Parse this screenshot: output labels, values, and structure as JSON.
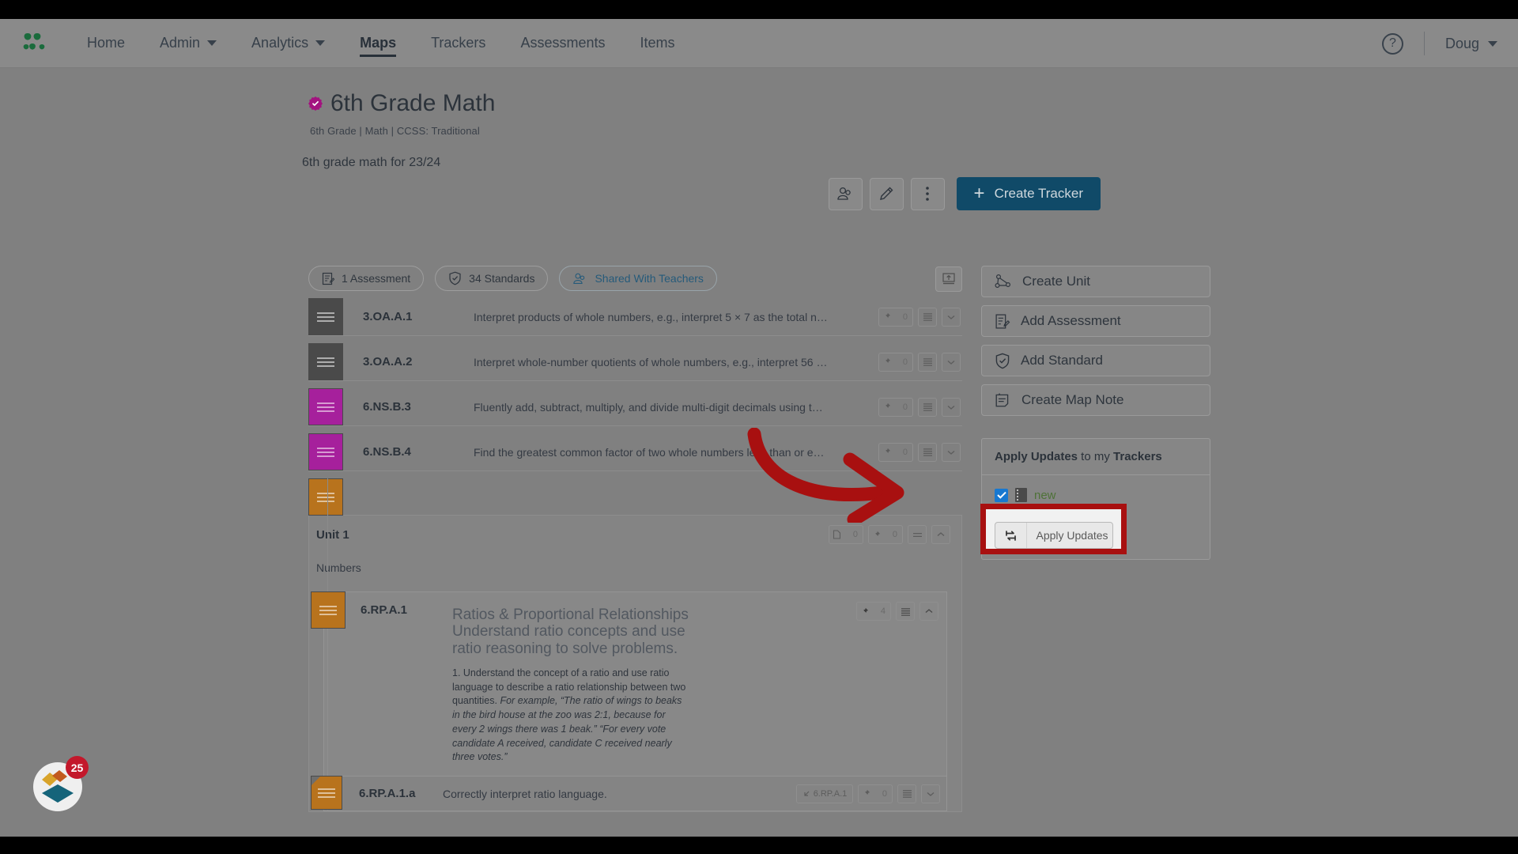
{
  "nav": {
    "logo_icon": "leaf-cluster-logo",
    "links": [
      {
        "label": "Home",
        "has_caret": false,
        "active": false
      },
      {
        "label": "Admin",
        "has_caret": true,
        "active": false
      },
      {
        "label": "Analytics",
        "has_caret": true,
        "active": false
      },
      {
        "label": "Maps",
        "has_caret": false,
        "active": true
      },
      {
        "label": "Trackers",
        "has_caret": false,
        "active": false
      },
      {
        "label": "Assessments",
        "has_caret": false,
        "active": false
      },
      {
        "label": "Items",
        "has_caret": false,
        "active": false
      }
    ],
    "help_label": "?",
    "user_name": "Doug"
  },
  "page": {
    "title": "6th Grade Math",
    "meta": "6th Grade | Math | CCSS: Traditional",
    "description": "6th grade math for 23/24",
    "actions": {
      "share_icon": "people-icon",
      "edit_icon": "pencil-icon",
      "more_icon": "kebab-menu-icon",
      "create_tracker_label": "Create Tracker",
      "plus": "+"
    },
    "chips": [
      {
        "label": "1 Assessment",
        "icon": "assessment-icon"
      },
      {
        "label": "34 Standards",
        "icon": "shield-check-icon"
      },
      {
        "label": "Shared With Teachers",
        "icon": "people-icon"
      }
    ],
    "export_icon": "export-icon"
  },
  "standards": [
    {
      "code": "3.OA.A.1",
      "description": "Interpret products of whole numbers, e.g., interpret 5 × 7 as the total n…",
      "color": "grey",
      "pin_count": "0"
    },
    {
      "code": "3.OA.A.2",
      "description": "Interpret whole-number quotients of whole numbers, e.g., interpret 56 …",
      "color": "grey",
      "pin_count": "0"
    },
    {
      "code": "6.NS.B.3",
      "description": "Fluently add, subtract, multiply, and divide multi-digit decimals using t…",
      "color": "magenta",
      "pin_count": "0"
    },
    {
      "code": "6.NS.B.4",
      "description": "Find the greatest common factor of two whole numbers less than or e…",
      "color": "magenta",
      "pin_count": "0"
    }
  ],
  "unit": {
    "color": "orange",
    "title": "Unit 1",
    "subtitle": "Numbers",
    "doc_count": "0",
    "pin_count": "0",
    "card": {
      "code": "6.RP.A.1",
      "color": "orange",
      "heading_1": "Ratios & Proportional Relationships",
      "heading_2": "Understand ratio concepts and use ratio reasoning to solve problems.",
      "body_lead": "1. Understand the concept of a ratio and use ratio language to describe a ratio relationship between two quantities.",
      "body_italic": "For example, “The ratio of wings to beaks in the bird house at the zoo was 2:1, because for every 2 wings there was 1 beak.” “For every vote candidate A received, candidate C received nearly three votes.”",
      "pin_count": "4"
    },
    "sub_row": {
      "code": "6.RP.A.1.a",
      "description": "Correctly interpret ratio language.",
      "parent_tag": "6.RP.A.1",
      "pin_count": "0",
      "color": "orange"
    }
  },
  "sidebar": {
    "buttons": [
      {
        "label": "Create Unit",
        "icon": "unit-network-icon"
      },
      {
        "label": "Add Assessment",
        "icon": "assessment-edit-icon"
      },
      {
        "label": "Add Standard",
        "icon": "shield-check-icon"
      },
      {
        "label": "Create Map Note",
        "icon": "note-icon"
      }
    ],
    "apply_panel": {
      "title_bold_1": "Apply Updates",
      "title_mid": " to my ",
      "title_bold_2": "Trackers",
      "tracker_name": "new",
      "tracker_checked": true,
      "apply_button_label": "Apply Updates",
      "apply_button_icon": "sync-arrows-icon"
    }
  },
  "widget": {
    "badge_count": "25",
    "icon": "diamond-logo-icon"
  },
  "annotation": {
    "arrow_color": "#a81010",
    "highlight_border_color": "#a81010"
  },
  "colors": {
    "primary_button": "#104a68",
    "swatch_grey": "#4a4a4a",
    "swatch_magenta": "#a6209c",
    "swatch_orange": "#b8731d",
    "logo_green": "#1a6b3c",
    "badge_red": "#c3182b",
    "tracker_green": "#4e7238"
  }
}
